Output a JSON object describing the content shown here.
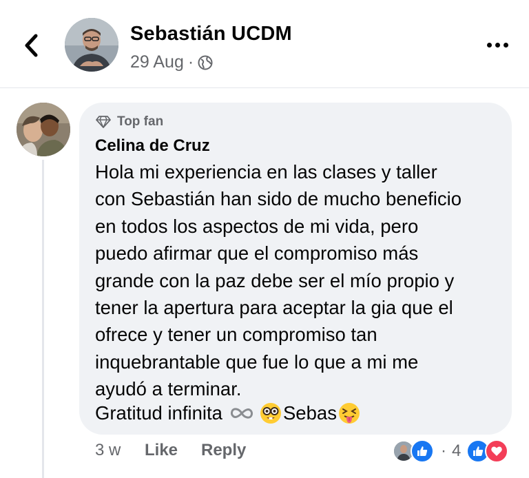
{
  "post": {
    "author_name": "Sebastián UCDM",
    "date": "29 Aug",
    "separator": "·",
    "audience_icon": "globe-icon",
    "more_icon": "more-dots-icon",
    "back_icon": "chevron-left-icon"
  },
  "comment": {
    "badge_label": "Top fan",
    "badge_icon": "diamond-icon",
    "author_name": "Celina de Cruz",
    "text": "Hola mi experiencia en las clases y taller\ncon Sebastián han sido de mucho beneficio\nen todos los aspectos de mi vida, pero\npuedo afirmar que el compromiso más\ngrande con la paz debe ser el mío propio y\ntener la apertura para aceptar la gia que el\nofrece y tener un compromiso tan\ninquebrantable que fue lo que a mi me\nayudó a terminar.",
    "closing_text": "Gratitud infinita",
    "closing_name": "Sebas",
    "closing_emojis": [
      "infinity-icon",
      "nerd-face-emoji",
      "tongue-squint-emoji"
    ]
  },
  "comment_actions": {
    "time": "3 w",
    "like_label": "Like",
    "reply_label": "Reply",
    "separator": "·",
    "reaction_count": "4",
    "reactions": [
      "like-icon",
      "love-icon"
    ]
  },
  "colors": {
    "accent_blue": "#1877f2",
    "love_red": "#f33e58",
    "bubble_bg": "#f0f2f5",
    "meta_gray": "#65676b"
  }
}
